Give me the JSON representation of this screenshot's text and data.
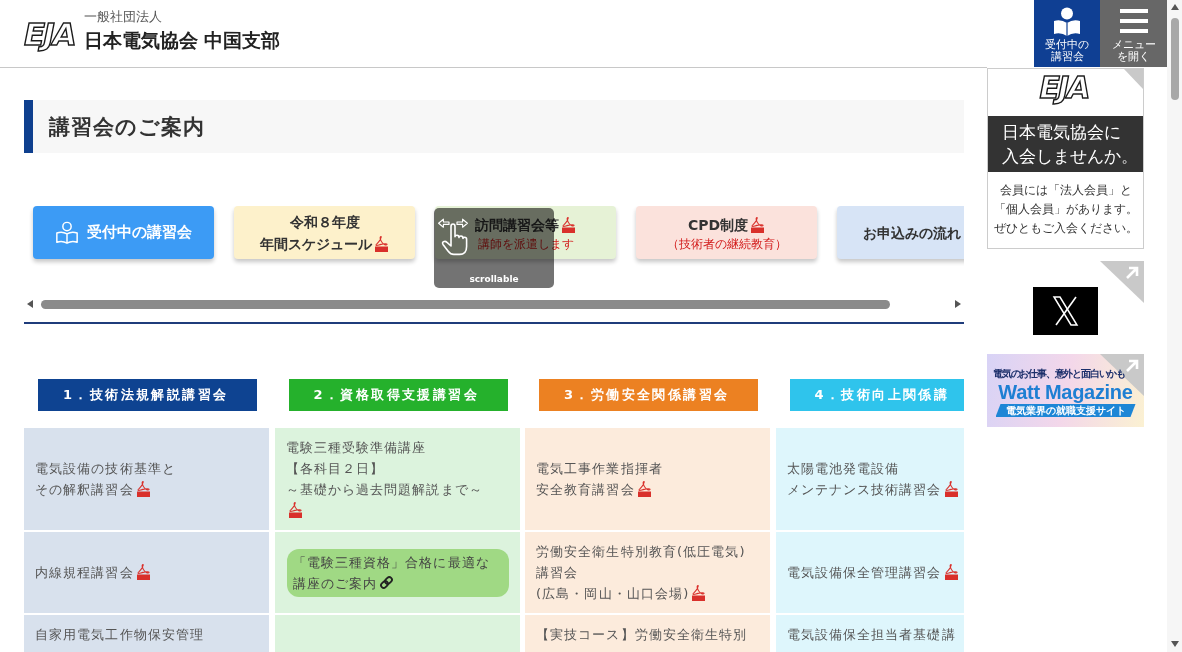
{
  "header": {
    "logo_text": "EJA",
    "org_type": "一般社団法人",
    "org_name": "日本電気協会 中国支部",
    "buttons": [
      {
        "kind": "courses",
        "lines": [
          "受付中の",
          "講習会"
        ]
      },
      {
        "kind": "menu",
        "lines": [
          "メニュー",
          "を開く"
        ]
      }
    ]
  },
  "page_title": "講習会のご案内",
  "tabs": [
    {
      "kind": "featured",
      "lines": [
        "受付中の講習会"
      ],
      "pdf": false,
      "color": "#3c9bf5"
    },
    {
      "kind": "link",
      "lines": [
        "令和８年度",
        "年間スケジュール"
      ],
      "pdf": true,
      "color": "#fdf1cb"
    },
    {
      "kind": "link",
      "lines": [
        "訪問講習会等"
      ],
      "pdf": true,
      "subtitle": "講師を派遣します",
      "color": "#e6f2d6"
    },
    {
      "kind": "link",
      "lines": [
        "CPD制度"
      ],
      "pdf": true,
      "subtitle": "（技術者の継続教育）",
      "color": "#fbe2dc"
    },
    {
      "kind": "link",
      "lines": [
        "お申込みの流れ"
      ],
      "pdf": false,
      "color": "#d7e4f6"
    }
  ],
  "scroll_hint": {
    "label": "scrollable"
  },
  "categories": [
    {
      "title": "1．技術法規解説講習会",
      "color": "#0e4391",
      "cells": [
        {
          "kind": "course",
          "lines": [
            "電気設備の技術基準と",
            "その解釈講習会"
          ],
          "pdf": true
        },
        {
          "kind": "course",
          "lines": [
            "内線規程講習会"
          ],
          "pdf": true
        },
        {
          "kind": "course",
          "lines": [
            "自家用電気工作物保安管理"
          ],
          "pdf": false
        }
      ]
    },
    {
      "title": "2．資格取得支援講習会",
      "color": "#25b12c",
      "cells": [
        {
          "kind": "course",
          "lines": [
            "電験三種受験準備講座",
            "【各科目２日】",
            "～基礎から過去問題解説まで～"
          ],
          "pdf": true
        },
        {
          "kind": "guide",
          "lines": [
            "「電験三種資格」合格に最適な",
            "講座のご案内"
          ]
        },
        {
          "kind": "empty"
        }
      ]
    },
    {
      "title": "3．労働安全関係講習会",
      "color": "#ec8122",
      "cells": [
        {
          "kind": "course",
          "lines": [
            "電気工事作業指揮者",
            "安全教育講習会"
          ],
          "pdf": true
        },
        {
          "kind": "course",
          "lines": [
            "労働安全衛生特別教育(低圧電気)",
            "講習会",
            "(広島・岡山・山口会場)"
          ],
          "pdf": true
        },
        {
          "kind": "course",
          "lines": [
            "【実技コース】労働安全衛生特別"
          ],
          "pdf": false
        }
      ]
    },
    {
      "title": "4．技術向上関係講",
      "color": "#2fc4ec",
      "cells": [
        {
          "kind": "course",
          "lines": [
            "太陽電池発電設備",
            "メンテナンス技術講習会"
          ],
          "pdf": true
        },
        {
          "kind": "course",
          "lines": [
            "電気設備保全管理講習会"
          ],
          "pdf": true
        },
        {
          "kind": "course",
          "lines": [
            "電気設備保全担当者基礎講"
          ],
          "pdf": false
        }
      ]
    }
  ],
  "sidebar": [
    {
      "kind": "join",
      "logo_text": "EJA",
      "heading_lines": [
        "日本電気協会に",
        "入会しませんか。"
      ],
      "body_lines": [
        "会員には「法人会員」と",
        "「個人会員」があります。",
        "ぜひともご入会ください。"
      ]
    },
    {
      "kind": "social"
    },
    {
      "kind": "banner",
      "tagline": "電気のお仕事、意外と面白いかも",
      "title": "Watt Magazine",
      "band": "電気業界の就職支援サイト"
    }
  ]
}
